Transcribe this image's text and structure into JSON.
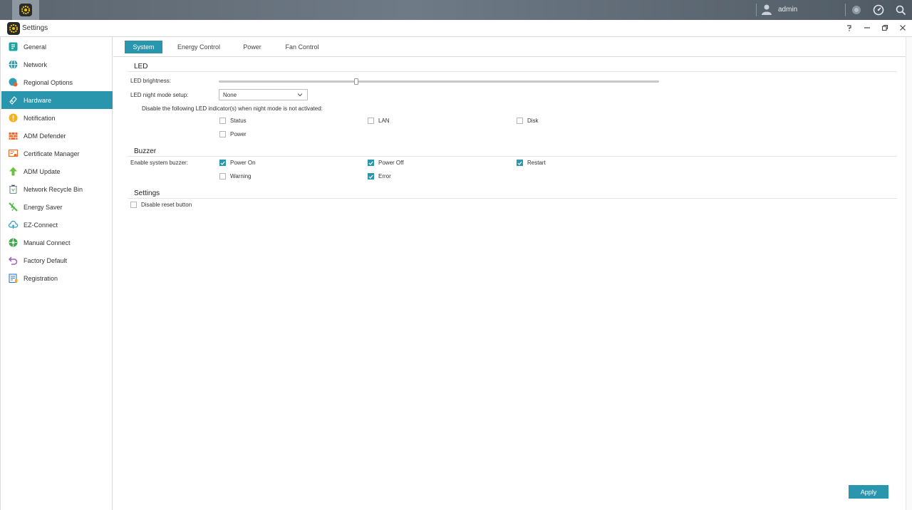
{
  "topbar": {
    "username": "admin"
  },
  "window": {
    "title": "Settings"
  },
  "sidebar": {
    "items": [
      {
        "label": "General",
        "icon": "general-icon",
        "color": "#18a4a4"
      },
      {
        "label": "Network",
        "icon": "globe-icon",
        "color": "#2e9fb7"
      },
      {
        "label": "Regional Options",
        "icon": "regional-icon",
        "color": "#2e9fb7"
      },
      {
        "label": "Hardware",
        "icon": "hardware-icon",
        "color": "#ffffff",
        "active": true
      },
      {
        "label": "Notification",
        "icon": "notification-icon",
        "color": "#f5b21b"
      },
      {
        "label": "ADM Defender",
        "icon": "firewall-icon",
        "color": "#e8672b"
      },
      {
        "label": "Certificate Manager",
        "icon": "certificate-icon",
        "color": "#e8672b"
      },
      {
        "label": "ADM Update",
        "icon": "update-arrow-icon",
        "color": "#6cc13f"
      },
      {
        "label": "Network Recycle Bin",
        "icon": "recycle-bin-icon",
        "color": "#7a8a96"
      },
      {
        "label": "Energy Saver",
        "icon": "energy-icon",
        "color": "#56b84a"
      },
      {
        "label": "EZ-Connect",
        "icon": "cloud-icon",
        "color": "#2e9fb7"
      },
      {
        "label": "Manual Connect",
        "icon": "manual-connect-icon",
        "color": "#3fae49"
      },
      {
        "label": "Factory Default",
        "icon": "undo-icon",
        "color": "#a259c4"
      },
      {
        "label": "Registration",
        "icon": "registration-icon",
        "color": "#2e79c9"
      }
    ]
  },
  "tabs": [
    {
      "label": "System",
      "active": true
    },
    {
      "label": "Energy Control"
    },
    {
      "label": "Power"
    },
    {
      "label": "Fan Control"
    }
  ],
  "led": {
    "title": "LED",
    "brightness_label": "LED brightness:",
    "brightness_level": 0.31,
    "night_mode_label": "LED night mode setup:",
    "night_mode_value": "None",
    "disable_note": "Disable the following LED indicator(s) when night mode is not activated:",
    "indicators": [
      {
        "label": "Status",
        "checked": false
      },
      {
        "label": "LAN",
        "checked": false
      },
      {
        "label": "Disk",
        "checked": false
      },
      {
        "label": "Power",
        "checked": false
      }
    ]
  },
  "buzzer": {
    "title": "Buzzer",
    "enable_label": "Enable system buzzer:",
    "options": [
      {
        "label": "Power On",
        "checked": true
      },
      {
        "label": "Power Off",
        "checked": true
      },
      {
        "label": "Restart",
        "checked": true
      },
      {
        "label": "Warning",
        "checked": false
      },
      {
        "label": "Error",
        "checked": true
      }
    ]
  },
  "settings": {
    "title": "Settings",
    "disable_reset_label": "Disable reset button",
    "disable_reset_checked": false
  },
  "footer": {
    "apply_label": "Apply"
  },
  "colors": {
    "accent": "#2996ad"
  }
}
